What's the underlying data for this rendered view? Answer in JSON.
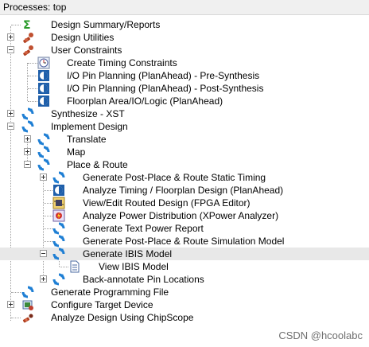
{
  "header": {
    "title": "Processes: top"
  },
  "tree": {
    "design_summary": "Design Summary/Reports",
    "design_utilities": "Design Utilities",
    "user_constraints": "User Constraints",
    "create_timing": "Create Timing Constraints",
    "io_pre": "I/O Pin Planning (PlanAhead) - Pre-Synthesis",
    "io_post": "I/O Pin Planning (PlanAhead) - Post-Synthesis",
    "floorplan": "Floorplan Area/IO/Logic (PlanAhead)",
    "synthesize": "Synthesize - XST",
    "implement": "Implement Design",
    "translate": "Translate",
    "map": "Map",
    "place_route": "Place & Route",
    "gen_static_timing": "Generate Post-Place & Route Static Timing",
    "analyze_timing": "Analyze Timing / Floorplan Design (PlanAhead)",
    "view_routed": "View/Edit Routed Design (FPGA Editor)",
    "analyze_power": "Analyze Power Distribution (XPower Analyzer)",
    "gen_text_power": "Generate Text Power Report",
    "gen_sim_model": "Generate Post-Place & Route Simulation Model",
    "gen_ibis": "Generate IBIS Model",
    "view_ibis": "View IBIS Model",
    "back_annotate": "Back-annotate Pin Locations",
    "gen_programming": "Generate Programming File",
    "configure_device": "Configure Target Device",
    "chipscope": "Analyze Design Using ChipScope"
  },
  "watermark": "CSDN @hcoolabc",
  "colors": {
    "process_blue": "#1f7fd4",
    "sigma_green": "#2a9a2a",
    "selected_row": "#e8e8e8"
  }
}
